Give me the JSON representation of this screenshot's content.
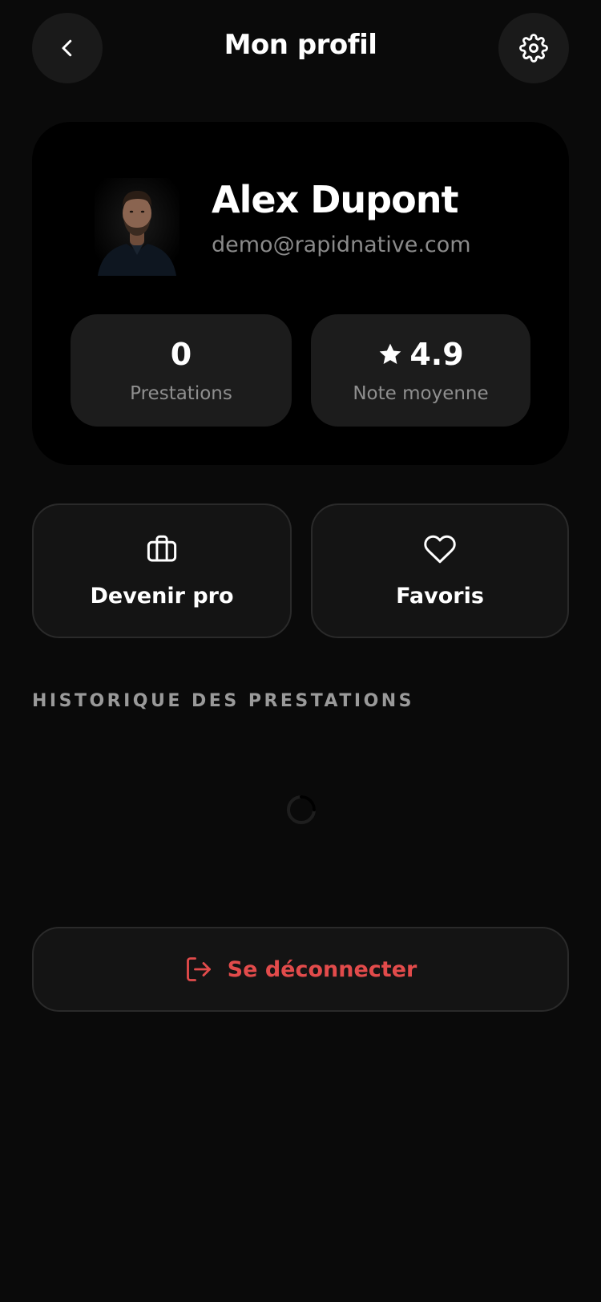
{
  "header": {
    "title": "Mon profil",
    "back_icon": "chevron-left-icon",
    "settings_icon": "gear-icon"
  },
  "profile": {
    "name": "Alex Dupont",
    "email": "demo@rapidnative.com",
    "avatar": "portrait photo of a bearded man in a dark shirt"
  },
  "stats": [
    {
      "value": "0",
      "label": "Prestations"
    },
    {
      "value": "4.9",
      "label": "Note moyenne",
      "icon": "star-icon"
    }
  ],
  "actions": [
    {
      "label": "Devenir pro",
      "icon": "briefcase-icon"
    },
    {
      "label": "Favoris",
      "icon": "heart-icon"
    }
  ],
  "history": {
    "title": "HISTORIQUE DES PRESTATIONS",
    "loading": true
  },
  "logout": {
    "label": "Se déconnecter",
    "icon": "logout-icon"
  },
  "colors": {
    "background": "#0a0a0a",
    "card": "#000000",
    "tile": "#141414",
    "danger": "#e24b4b",
    "muted": "#8a8a8a"
  }
}
